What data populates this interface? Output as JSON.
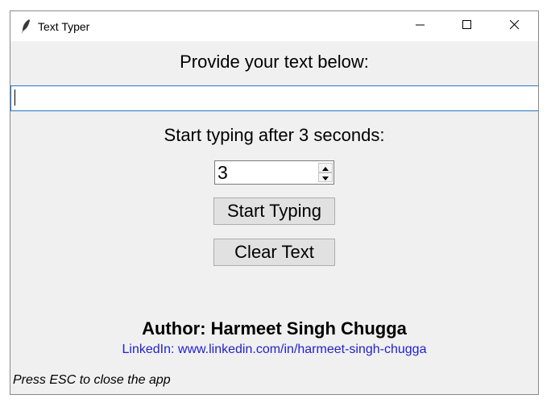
{
  "window": {
    "title": "Text Typer",
    "app_icon": "feather-icon"
  },
  "controls": {
    "minimize_icon": "minimize-icon",
    "maximize_icon": "maximize-icon",
    "close_icon": "close-icon"
  },
  "main": {
    "prompt_label": "Provide your text below:",
    "text_input_value": "",
    "delay_label": "Start typing after 3 seconds:",
    "delay_value": "3",
    "start_button_label": "Start Typing",
    "clear_button_label": "Clear Text"
  },
  "footer": {
    "author": "Author: Harmeet Singh Chugga",
    "linkedin": "LinkedIn: www.linkedin.com/in/harmeet-singh-chugga",
    "hint": "Press ESC to close the app"
  },
  "colors": {
    "window_bg": "#f0f0f0",
    "link": "#2222cc",
    "input_focus_border": "#2a76c4"
  }
}
